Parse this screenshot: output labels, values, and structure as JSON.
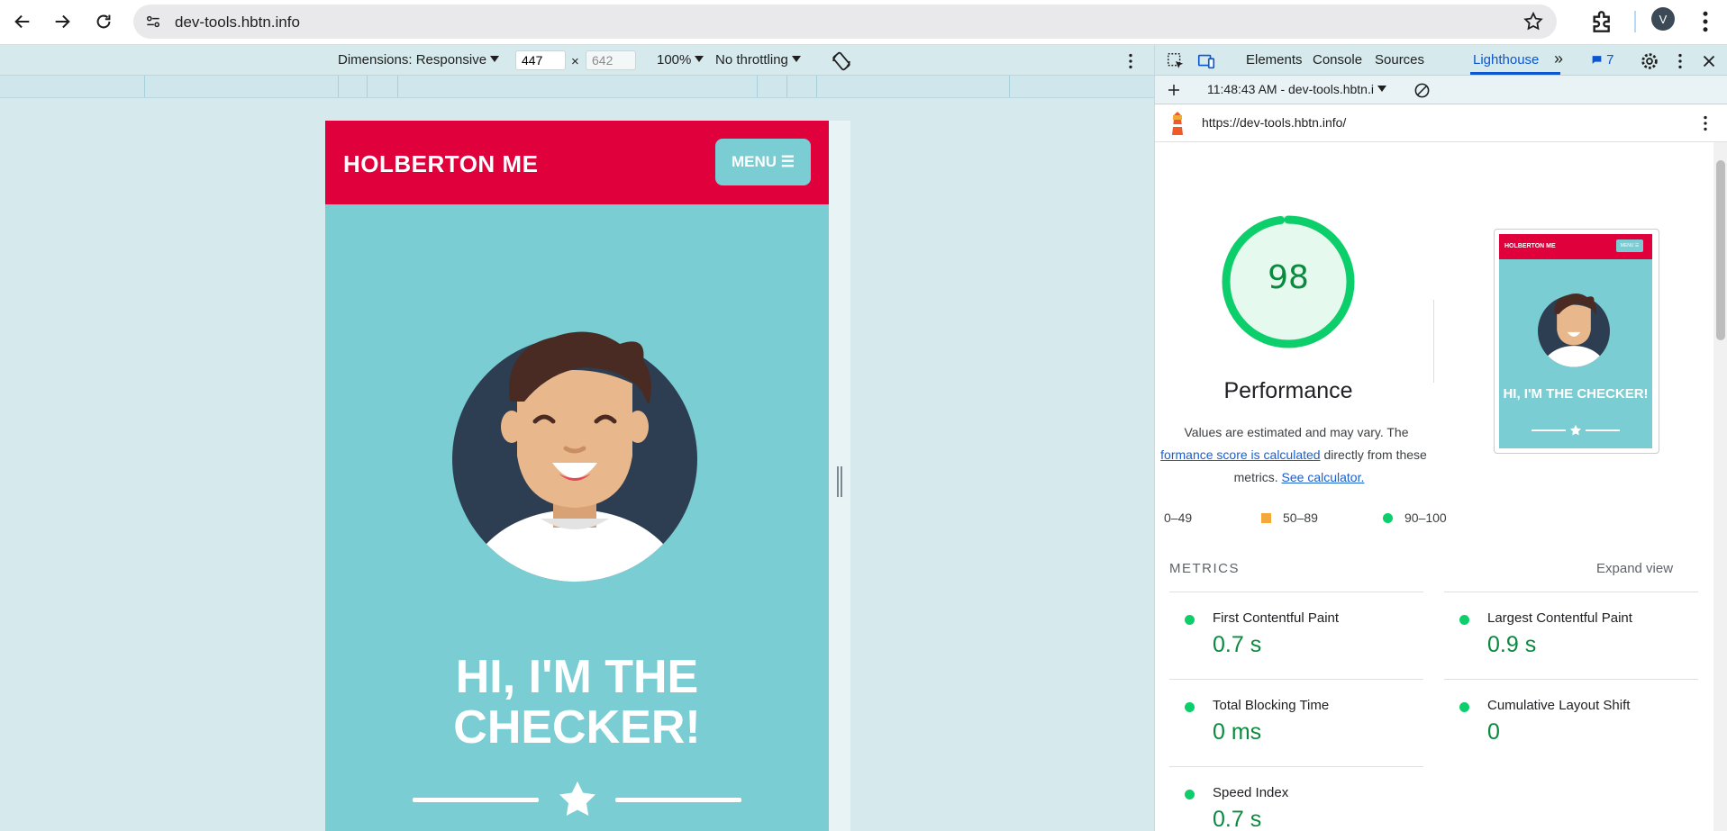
{
  "browser": {
    "url": "dev-tools.hbtn.info",
    "avatar_letter": "V"
  },
  "device_toolbar": {
    "dimensions_label": "Dimensions: Responsive",
    "width": "447",
    "times": "×",
    "height": "642",
    "zoom": "100%",
    "throttling": "No throttling"
  },
  "emulated_page": {
    "brand": "HOLBERTON ME",
    "menu_label": "MENU ☰",
    "title_line1": "HI, I'M THE",
    "title_line2": "CHECKER!"
  },
  "devtools": {
    "tabs": [
      "Elements",
      "Console",
      "Sources",
      "Lighthouse"
    ],
    "active_tab": "Lighthouse",
    "more_tabs": "»",
    "issues_count": "7",
    "report_time": "11:48:43 AM - dev-tools.hbtn.i",
    "report_url": "https://dev-tools.hbtn.info/"
  },
  "report": {
    "score": "98",
    "score_fraction": 0.98,
    "category": "Performance",
    "note_line1": "Values are estimated and may vary. The",
    "note_link1": "formance score is calculated",
    "note_line2_rest": " directly from these",
    "note_line3_prefix": "metrics. ",
    "note_link2": "See calculator.",
    "thumbnail": {
      "brand": "HOLBERTON ME",
      "menu": "MENU ☰",
      "title": "HI, I'M THE CHECKER!"
    },
    "legend": {
      "fail": "0–49",
      "average": "50–89",
      "pass": "90–100"
    },
    "metrics_heading": "METRICS",
    "expand_view": "Expand view",
    "metrics": [
      {
        "label": "First Contentful Paint",
        "value": "0.7 s"
      },
      {
        "label": "Largest Contentful Paint",
        "value": "0.9 s"
      },
      {
        "label": "Total Blocking Time",
        "value": "0 ms"
      },
      {
        "label": "Cumulative Layout Shift",
        "value": "0"
      },
      {
        "label": "Speed Index",
        "value": "0.7 s"
      }
    ]
  },
  "colors": {
    "pass": "#0cce6b",
    "average": "#f4a83a",
    "fail": "#ff4e42",
    "brand_red": "#e0003b",
    "teal": "#79cdd3",
    "link": "#1a5fd1"
  }
}
